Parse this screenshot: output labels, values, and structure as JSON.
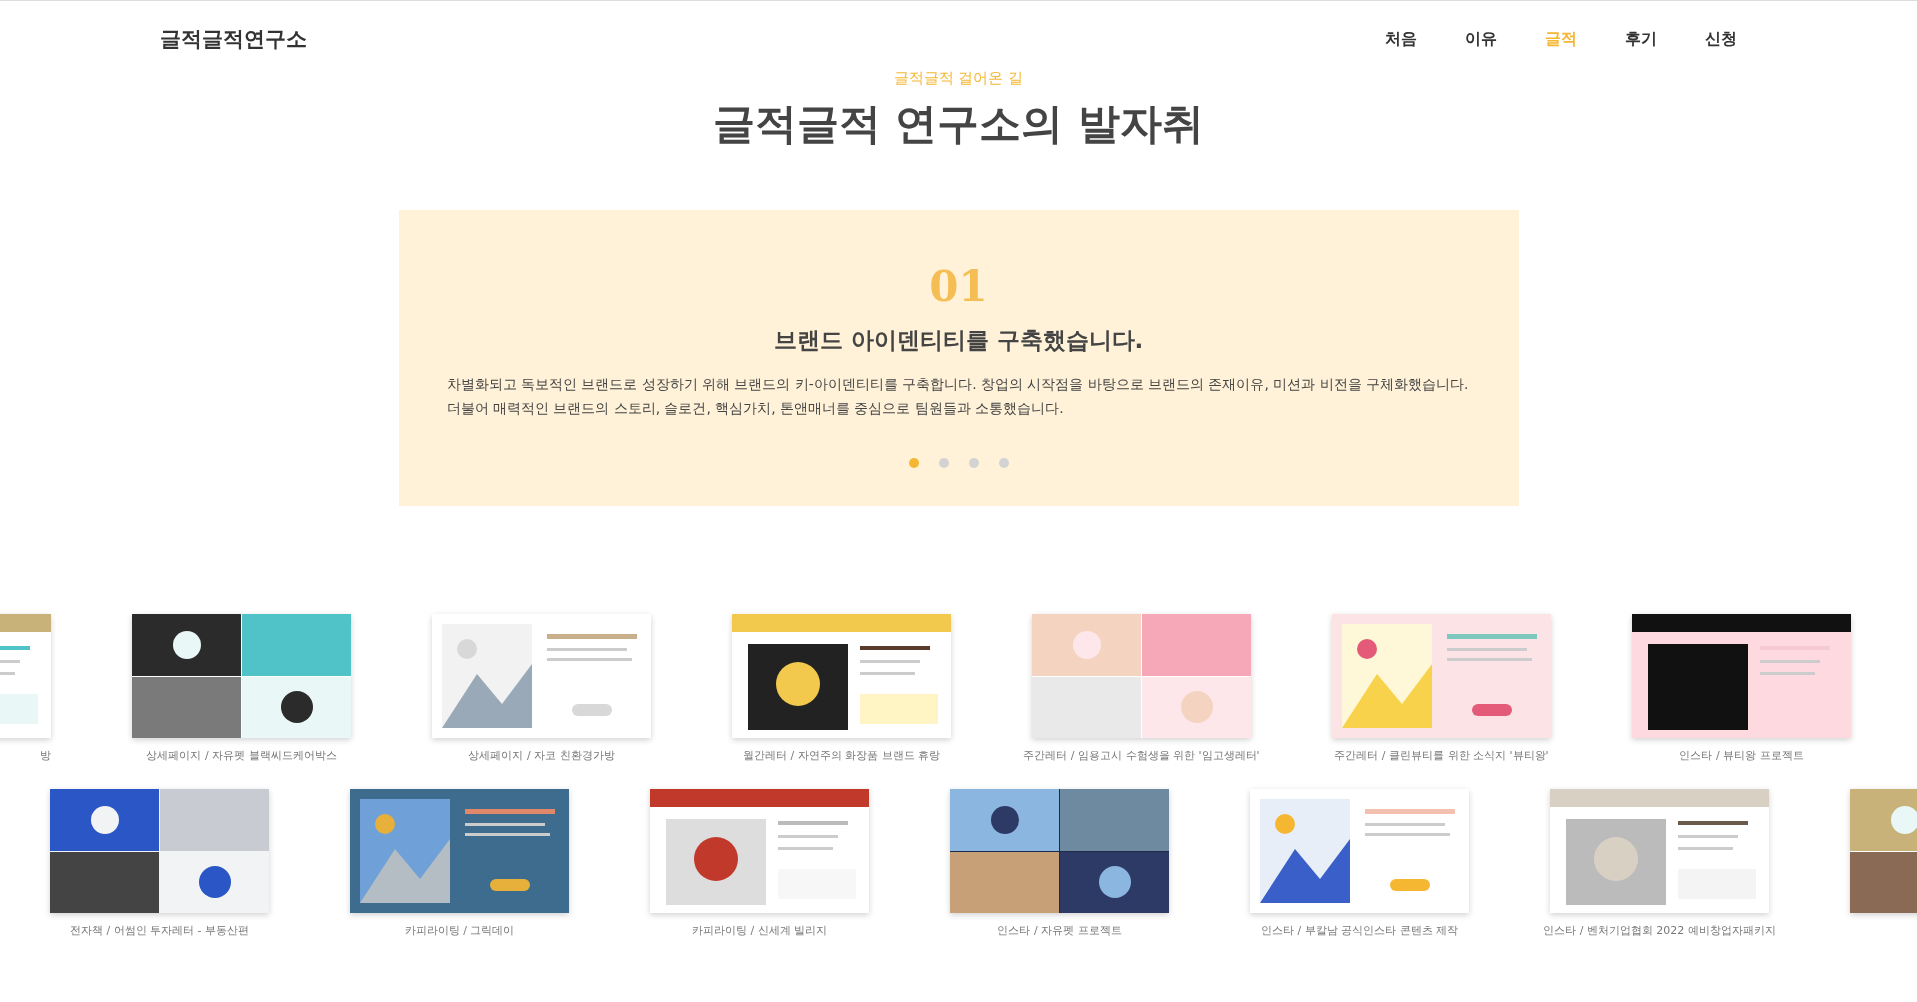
{
  "header": {
    "logo": "글적글적연구소",
    "nav": [
      {
        "label": "처음",
        "selected": false
      },
      {
        "label": "이유",
        "selected": false
      },
      {
        "label": "글적",
        "selected": true
      },
      {
        "label": "후기",
        "selected": false
      },
      {
        "label": "신청",
        "selected": false
      }
    ]
  },
  "section": {
    "eyebrow": "글적글적 걸어온 길",
    "title": "글적글적 연구소의 발자취"
  },
  "slide": {
    "number": "01",
    "heading": "브랜드 아이덴티티를 구축했습니다.",
    "lines": [
      "차별화되고 독보적인 브랜드로 성장하기 위해 브랜드의 키-아이덴티티를 구축합니다. 창업의 시작점을 바탕으로 브랜드의 존재이유, 미션과 비전을 구체화했습니다.",
      "더불어 매력적인 브랜드의 스토리, 슬로건, 핵심가치, 톤앤매너를 중심으로 팀원들과 소통했습니다."
    ],
    "dots": [
      {
        "selected": true
      },
      {
        "selected": false
      },
      {
        "selected": false
      },
      {
        "selected": false
      }
    ]
  },
  "gallery": [
    [
      {
        "kind": "picture",
        "caption": "방"
      },
      {
        "kind": "picture",
        "caption": "상세페이지 / 자유펫 블랙씨드케어박스"
      },
      {
        "kind": "picture",
        "caption": "상세페이지 / 자코 친환경가방"
      },
      {
        "kind": "picture",
        "caption": "월간레터 / 자연주의 화장품 브랜드 휴랑"
      },
      {
        "kind": "picture",
        "caption": "주간레터 / 임용고시 수험생을 위한 '임고생레터'"
      },
      {
        "kind": "picture",
        "caption": "주간레터 / 클린뷰티를 위한 소식지 '뷰티왕'"
      },
      {
        "kind": "picture",
        "caption": "인스타 / 뷰티왕 프로젝트"
      }
    ],
    [
      {
        "kind": "picture",
        "caption": "전자책 / 어썸인 투자레터 - 부동산편"
      },
      {
        "kind": "picture",
        "caption": "카피라이팅 / 그릭데이"
      },
      {
        "kind": "picture",
        "caption": "카피라이팅 / 신세계 빌리지"
      },
      {
        "kind": "picture",
        "caption": "인스타 / 자유펫 프로젝트"
      },
      {
        "kind": "picture",
        "caption": "인스타 / 부칼남 공식인스타 콘텐츠 제작"
      },
      {
        "kind": "picture",
        "caption": "인스타 / 벤처기업협회 2022 예비창업자패키지"
      },
      {
        "kind": "picture"
      }
    ]
  ]
}
